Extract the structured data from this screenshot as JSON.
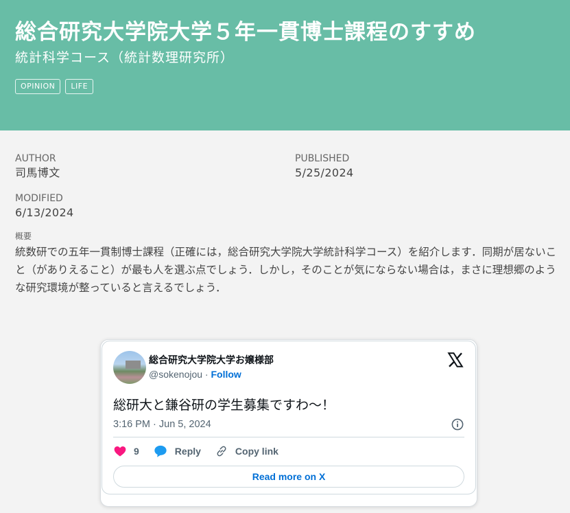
{
  "header": {
    "title": "総合研究大学院大学５年一貫博士課程のすすめ",
    "subtitle": "統計科学コース（統計数理研究所）",
    "tags": [
      "OPINION",
      "LIFE"
    ],
    "background_color": "#68bda6"
  },
  "meta": {
    "author_label": "AUTHOR",
    "author": "司馬博文",
    "published_label": "PUBLISHED",
    "published": "5/25/2024",
    "modified_label": "MODIFIED",
    "modified": "6/13/2024",
    "abstract_label": "概要",
    "abstract": "統数研での五年一貫制博士課程（正確には，総合研究大学院大学統計科学コース）を紹介します．同期が居ないこと（がありえること）が最も人を選ぶ点でしょう．しかし，そのことが気にならない場合は，まさに理想郷のような研究環境が整っていると言えるでしょう．"
  },
  "tweet": {
    "display_name": "総合研究大学院大学お嬢様部",
    "handle": "@sokenojou",
    "separator": " · ",
    "follow_label": "Follow",
    "text": "総研大と鎌谷研の学生募集ですわ〜！",
    "timestamp": "3:16 PM · Jun 5, 2024",
    "like_count": "9",
    "reply_label": "Reply",
    "copy_link_label": "Copy link",
    "read_more_label": "Read more on X",
    "icons": {
      "logo": "x-logo-icon",
      "info": "info-icon",
      "like": "heart-icon",
      "reply": "speech-bubble-icon",
      "copy": "link-icon"
    },
    "colors": {
      "link": "#006fd6",
      "heart": "#f91880",
      "reply": "#1d9bf0"
    }
  }
}
